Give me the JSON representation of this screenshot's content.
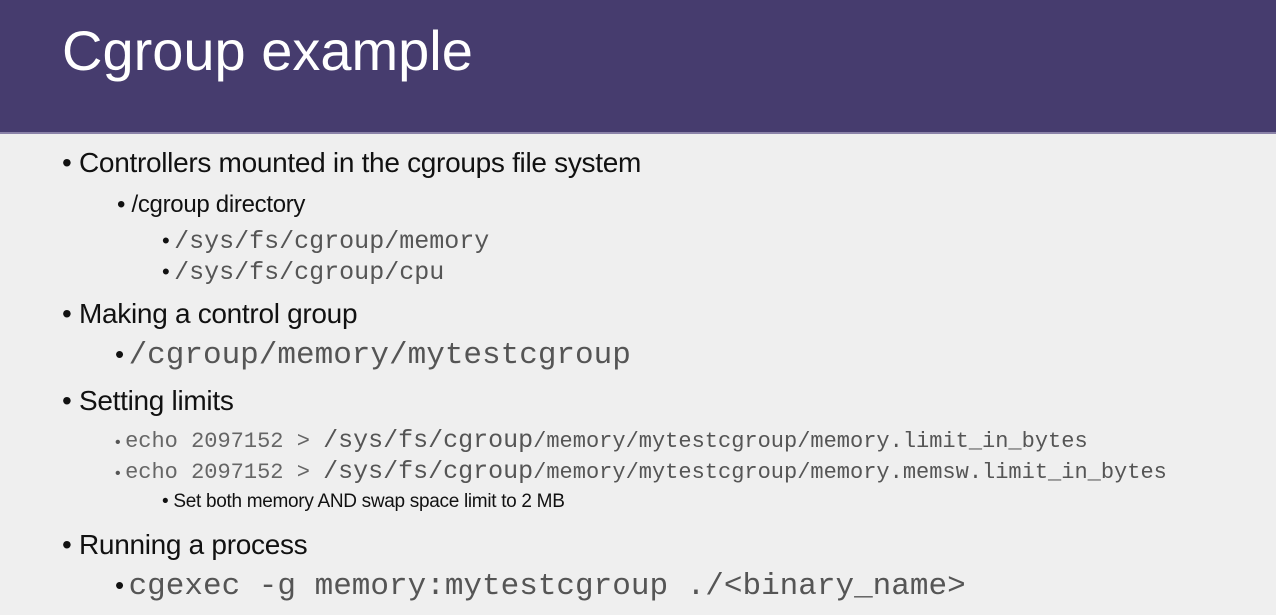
{
  "title": "Cgroup example",
  "bullets": {
    "controllers": "Controllers mounted in the cgroups file system",
    "cgroup_dir": "/cgroup directory",
    "mem_path": "/sys/fs/cgroup/memory",
    "cpu_path": "/sys/fs/cgroup/cpu",
    "making": "Making a control group",
    "making_path": "/cgroup/memory/mytestcgroup",
    "setting": "Setting limits",
    "cmd1": {
      "echo": "echo 2097152 > ",
      "root": "/sys/fs/cgroup",
      "rest": "/memory/mytestcgroup/memory.limit_in_bytes"
    },
    "cmd2": {
      "echo": "echo 2097152 > ",
      "root": "/sys/fs/cgroup",
      "rest": "/memory/mytestcgroup/memory.memsw.limit_in_bytes"
    },
    "cmd_note": "Set both memory AND swap space limit to 2 MB",
    "running": "Running a process",
    "running_cmd": "cgexec -g memory:mytestcgroup ./<binary_name>"
  },
  "bullet_glyph": "•"
}
